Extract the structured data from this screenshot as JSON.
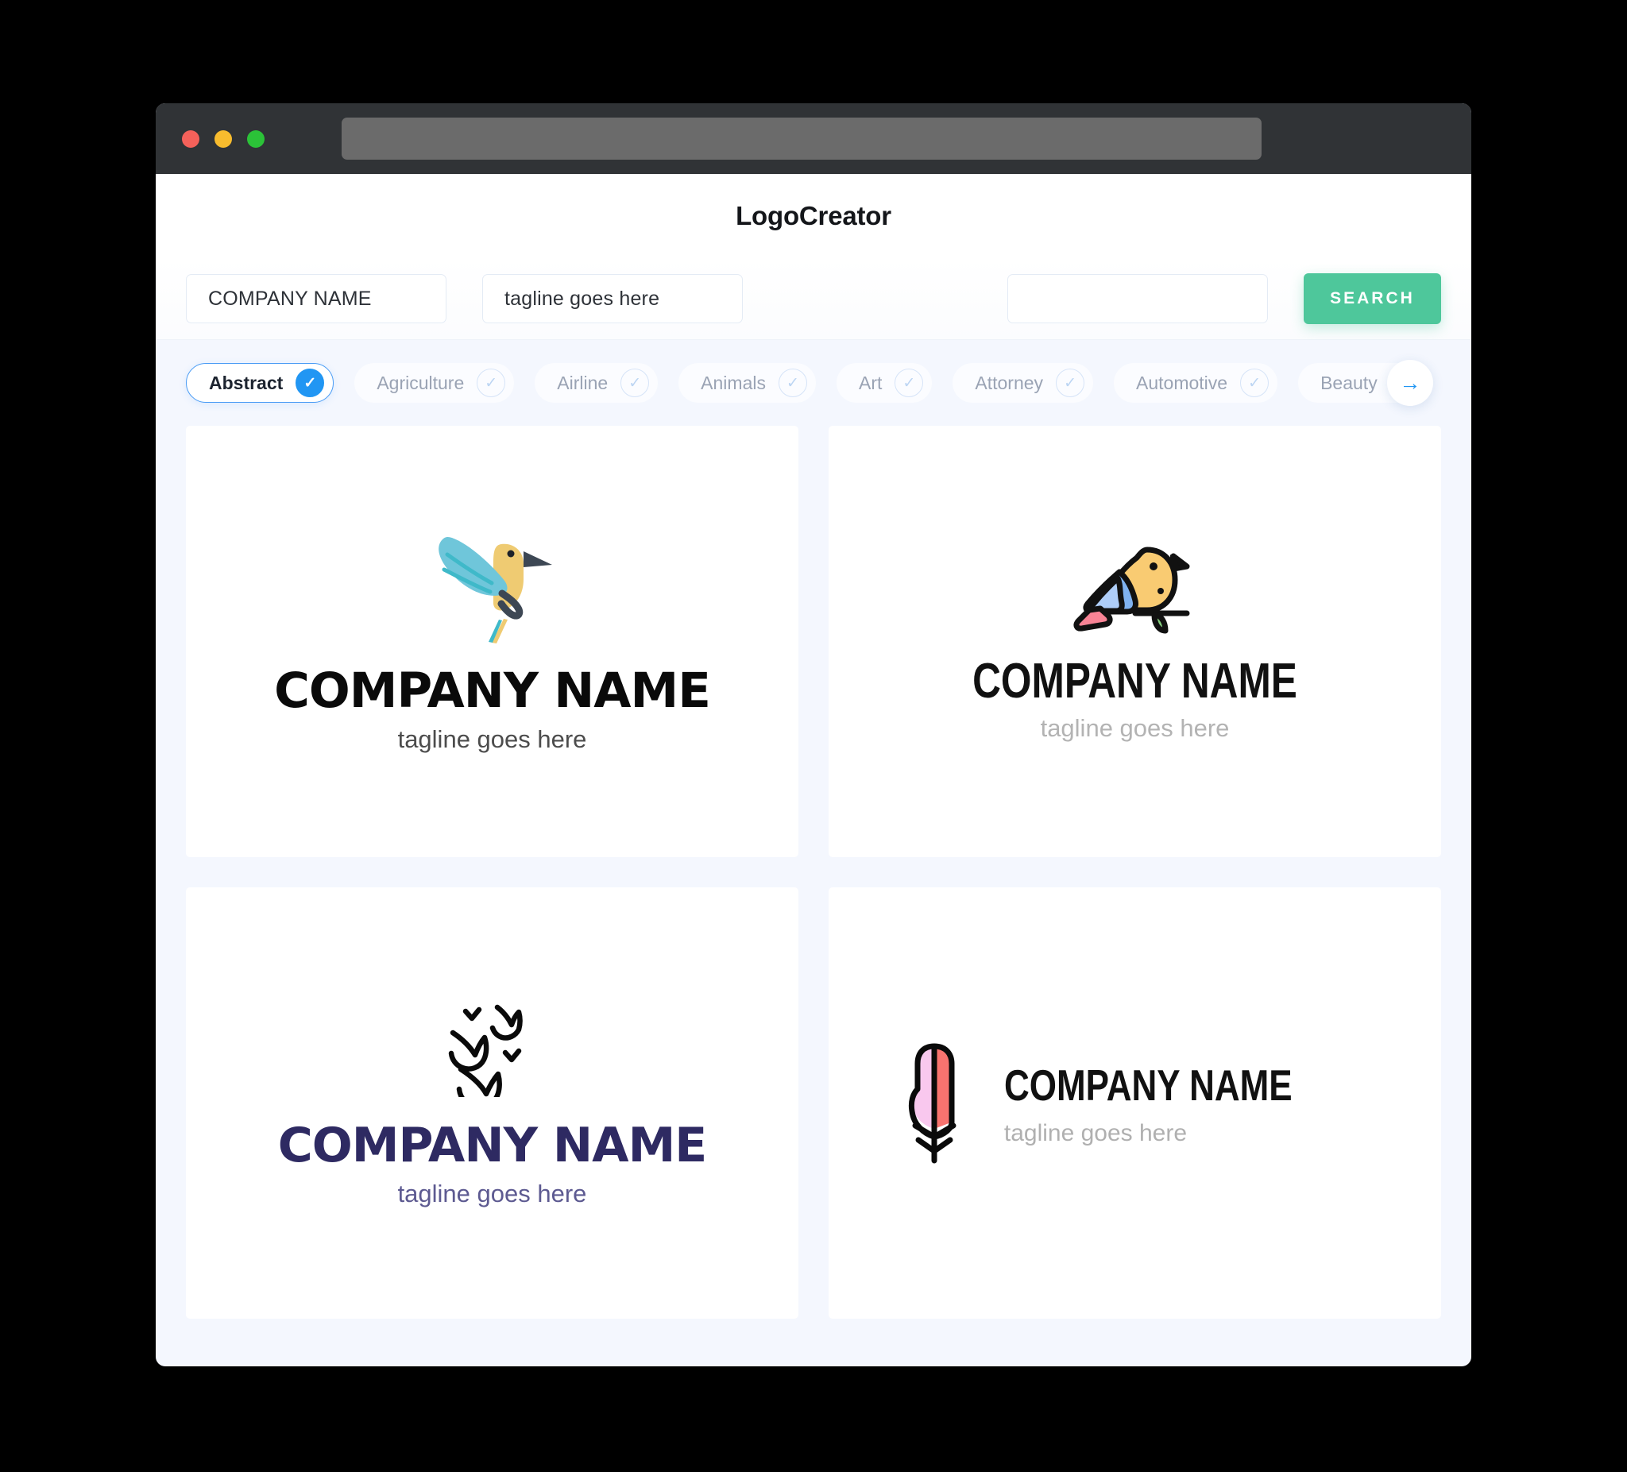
{
  "window": {
    "traffic_lights": [
      {
        "name": "close",
        "color": "#f4615a"
      },
      {
        "name": "minimize",
        "color": "#f8bc2e"
      },
      {
        "name": "maximize",
        "color": "#2bc238"
      }
    ],
    "url_value": ""
  },
  "header": {
    "title": "LogoCreator"
  },
  "search": {
    "company_name_value": "COMPANY NAME",
    "tagline_value": "tagline goes here",
    "keyword_value": "",
    "search_label": "SEARCH",
    "search_button_color": "#4ec79b"
  },
  "categories": {
    "items": [
      {
        "label": "Abstract",
        "selected": true
      },
      {
        "label": "Agriculture",
        "selected": false
      },
      {
        "label": "Airline",
        "selected": false
      },
      {
        "label": "Animals",
        "selected": false
      },
      {
        "label": "Art",
        "selected": false
      },
      {
        "label": "Attorney",
        "selected": false
      },
      {
        "label": "Automotive",
        "selected": false
      },
      {
        "label": "Beauty",
        "selected": false
      }
    ],
    "check_glyph": "✓",
    "next_glyph": "→",
    "selected_accent": "#2196f3"
  },
  "results": {
    "cards": [
      {
        "icon": "hummingbird-icon",
        "company_name": "COMPANY NAME",
        "tagline": "tagline goes here",
        "name_color": "#0a0a0a",
        "tagline_color": "#4c4c4c"
      },
      {
        "icon": "perched-bird-on-branch-icon",
        "company_name": "COMPANY NAME",
        "tagline": "tagline goes here",
        "name_color": "#111111",
        "tagline_color": "#b3b3b3"
      },
      {
        "icon": "flying-birds-flock-icon",
        "company_name": "COMPANY NAME",
        "tagline": "tagline goes here",
        "name_color": "#2e2a62",
        "tagline_color": "#5d5a91"
      },
      {
        "icon": "feather-quill-icon",
        "company_name": "COMPANY NAME",
        "tagline": "tagline goes here",
        "name_color": "#111111",
        "tagline_color": "#b0b0b0"
      }
    ]
  }
}
